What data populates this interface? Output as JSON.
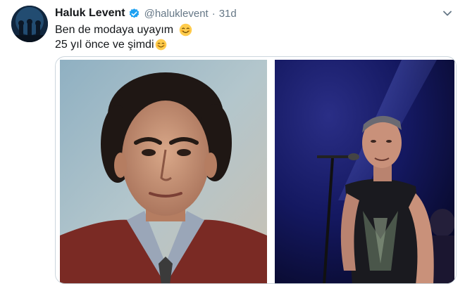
{
  "tweet": {
    "author_name": "Haluk Levent",
    "handle": "@haluklevent",
    "separator": "·",
    "time": "31d",
    "lines": [
      "Ben de modaya uyayım",
      "25 yıl önce ve şimdi"
    ]
  },
  "icons": {
    "verified": "verified-badge-icon",
    "caret": "chevron-down-icon",
    "emoji": "smiling-face-emoji"
  },
  "colors": {
    "verified": "#1da1f2",
    "muted": "#657786",
    "border": "#ccd6dd"
  }
}
